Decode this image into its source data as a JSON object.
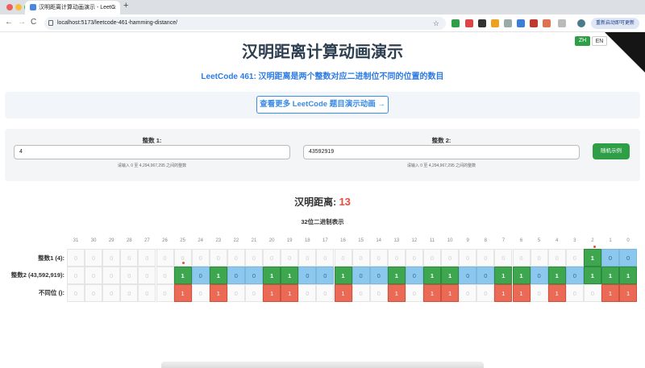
{
  "browser": {
    "tab_title": "汉明距离计算动画演示 - LeetC",
    "tab_close": "×",
    "new_tab": "+",
    "back": "←",
    "forward": "→",
    "reload": "C",
    "url": "localhost:5173/leetcode-461-hamming-distance/",
    "bookmark": "☆",
    "update_button": "重新启动即可更新"
  },
  "header": {
    "title": "汉明距离计算动画演示",
    "lang_zh": "ZH",
    "lang_en": "EN",
    "subtitle": "LeetCode 461: 汉明距离是两个整数对应二进制位不同的位置的数目"
  },
  "more_link": "查看更多 LeetCode 题目演示动画 →",
  "inputs": {
    "x_label": "整数 1:",
    "x_value": "4",
    "x_hint": "请输入 0 至 4,294,967,295 之间的整数",
    "y_label": "整数 2:",
    "y_value": "43592919",
    "y_hint": "请输入 0 至 4,294,967,295 之间的整数",
    "random_button": "随机示例"
  },
  "result": {
    "label": "汉明距离:",
    "value": "13"
  },
  "binary": {
    "title": "32位二进制表示",
    "row1_label": "整数1 (4):",
    "row2_label": "整数2 (43,592,919):",
    "row3_label": "不同位 ():",
    "indices": [
      "31",
      "30",
      "29",
      "28",
      "27",
      "26",
      "25",
      "24",
      "23",
      "22",
      "21",
      "20",
      "19",
      "18",
      "17",
      "16",
      "15",
      "14",
      "13",
      "12",
      "11",
      "10",
      "9",
      "8",
      "7",
      "6",
      "5",
      "4",
      "3",
      "2",
      "1",
      "0"
    ],
    "row1": [
      "0",
      "0",
      "0",
      "0",
      "0",
      "0",
      "0",
      "0",
      "0",
      "0",
      "0",
      "0",
      "0",
      "0",
      "0",
      "0",
      "0",
      "0",
      "0",
      "0",
      "0",
      "0",
      "0",
      "0",
      "0",
      "0",
      "0",
      "0",
      "0",
      "1",
      "0",
      "0"
    ],
    "row1_state": [
      "",
      "",
      "",
      "",
      "",
      "",
      "",
      "",
      "",
      "",
      "",
      "",
      "",
      "",
      "",
      "",
      "",
      "",
      "",
      "",
      "",
      "",
      "",
      "",
      "",
      "",
      "",
      "",
      "",
      "b1",
      "b0",
      "b0"
    ],
    "row2": [
      "0",
      "0",
      "0",
      "0",
      "0",
      "0",
      "1",
      "0",
      "1",
      "0",
      "0",
      "1",
      "1",
      "0",
      "0",
      "1",
      "0",
      "0",
      "1",
      "0",
      "1",
      "1",
      "0",
      "0",
      "1",
      "1",
      "0",
      "1",
      "0",
      "1",
      "1",
      "1"
    ],
    "row2_state": [
      "",
      "",
      "",
      "",
      "",
      "",
      "b1",
      "b0",
      "b1",
      "b0",
      "b0",
      "b1",
      "b1",
      "b0",
      "b0",
      "b1",
      "b0",
      "b0",
      "b1",
      "b0",
      "b1",
      "b1",
      "b0",
      "b0",
      "b1",
      "b1",
      "b0",
      "b1",
      "b0",
      "b1",
      "b1",
      "b1"
    ],
    "row3": [
      "0",
      "0",
      "0",
      "0",
      "0",
      "0",
      "1",
      "0",
      "1",
      "0",
      "0",
      "1",
      "1",
      "0",
      "0",
      "1",
      "0",
      "0",
      "1",
      "0",
      "1",
      "1",
      "0",
      "0",
      "1",
      "1",
      "0",
      "1",
      "0",
      "0",
      "1",
      "1"
    ],
    "row3_state": [
      "",
      "",
      "",
      "",
      "",
      "",
      "diff",
      "",
      "diff",
      "",
      "",
      "diff",
      "diff",
      "",
      "",
      "diff",
      "",
      "",
      "diff",
      "",
      "diff",
      "diff",
      "",
      "",
      "diff",
      "diff",
      "",
      "diff",
      "",
      "",
      "diff",
      "diff"
    ]
  },
  "colors": {
    "one": "#3fa650",
    "zero": "#8cc8ee",
    "diff": "#ea6a55",
    "accent": "#2c7be5"
  }
}
